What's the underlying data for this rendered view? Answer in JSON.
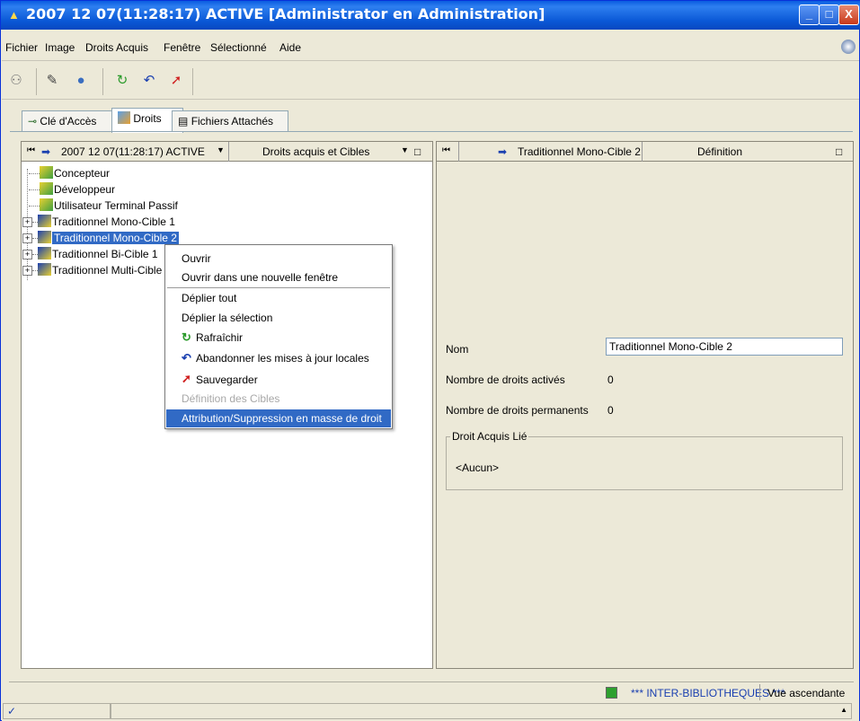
{
  "window": {
    "title": "2007 12 07(11:28:17) ACTIVE [Administrator en Administration]",
    "minimize": "_",
    "maximize": "□",
    "close": "X"
  },
  "menubar": [
    "Fichier",
    "Image",
    "Droits Acquis",
    "Fenêtre",
    "Sélectionné",
    "Aide"
  ],
  "tabs": [
    {
      "label": "Clé d'Accès",
      "icon": "key-icon"
    },
    {
      "label": "Droits",
      "icon": "rights-icon"
    },
    {
      "label": "Fichiers Attachés",
      "icon": "document-icon"
    }
  ],
  "left_panel": {
    "context_label": "2007 12 07(11:28:17) ACTIVE",
    "dropdown_label": "Droits acquis et Cibles",
    "tree": [
      {
        "label": "Concepteur",
        "expandable": false
      },
      {
        "label": "Développeur",
        "expandable": false
      },
      {
        "label": "Utilisateur Terminal Passif",
        "expandable": false
      },
      {
        "label": "Traditionnel Mono-Cible 1",
        "expandable": true
      },
      {
        "label": "Traditionnel Mono-Cible 2",
        "expandable": true,
        "selected": true
      },
      {
        "label": "Traditionnel Bi-Cible 1",
        "expandable": true
      },
      {
        "label": "Traditionnel Multi-Cible 1",
        "expandable": true
      }
    ]
  },
  "context_menu": {
    "items": [
      {
        "label": "Ouvrir"
      },
      {
        "label": "Ouvrir dans une nouvelle fenêtre"
      },
      {
        "label": "Déplier tout"
      },
      {
        "label": "Déplier la sélection"
      },
      {
        "label": "Rafraîchir",
        "icon": "refresh-icon"
      },
      {
        "label": "Abandonner les mises à jour locales",
        "icon": "undo-icon"
      },
      {
        "label": "Sauvegarder",
        "icon": "save-icon"
      },
      {
        "label": "Définition des Cibles",
        "disabled": true
      },
      {
        "label": "Attribution/Suppression en masse de droit",
        "highlighted": true
      }
    ]
  },
  "right_panel": {
    "header_label": "Traditionnel Mono-Cible 2",
    "header_title": "Définition",
    "fields": {
      "nom_label": "Nom",
      "nom_value": "Traditionnel Mono-Cible 2",
      "actives_label": "Nombre de droits activés",
      "actives_value": "0",
      "permanents_label": "Nombre de droits permanents",
      "permanents_value": "0"
    },
    "group": {
      "title": "Droit Acquis Lié",
      "value": "<Aucun>"
    }
  },
  "statusbar": {
    "library": "*** INTER-BIBLIOTHEQUES ***",
    "view": "Vue ascendante"
  },
  "colors": {
    "selection": "#316ac5",
    "menu_highlight": "#316ac5"
  }
}
